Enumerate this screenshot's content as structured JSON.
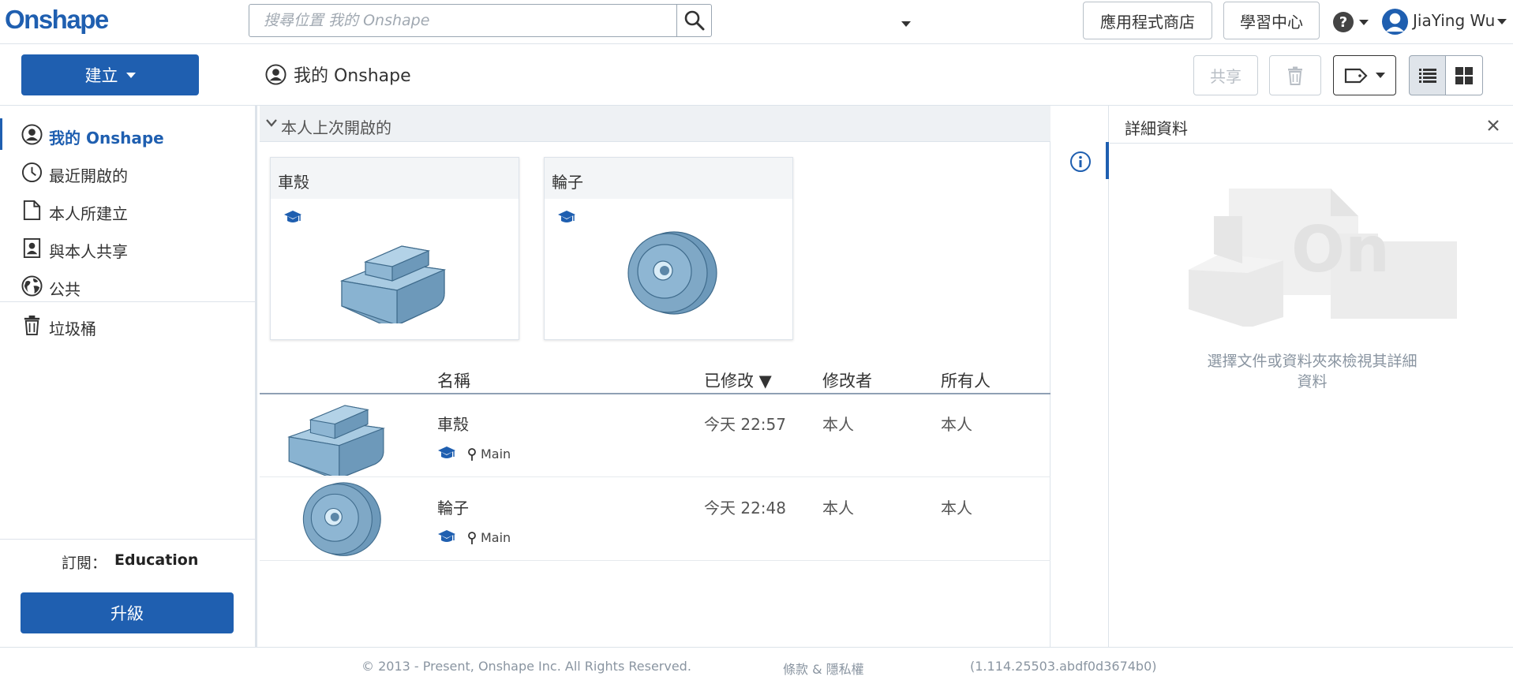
{
  "app": {
    "logo": "Onshape"
  },
  "search": {
    "placeholder": "搜尋位置 我的 Onshape"
  },
  "header": {
    "app_store_label": "應用程式商店",
    "learning_label": "學習中心",
    "user_name": "JiaYing Wu"
  },
  "toolbar": {
    "create_label": "建立",
    "page_title": "我的 Onshape",
    "share_label": "共享"
  },
  "sidebar": {
    "items": [
      {
        "label": "我的 Onshape",
        "icon": "user-circle-icon"
      },
      {
        "label": "最近開啟的",
        "icon": "clock-icon"
      },
      {
        "label": "本人所建立",
        "icon": "document-icon"
      },
      {
        "label": "與本人共享",
        "icon": "shared-user-icon"
      },
      {
        "label": "公共",
        "icon": "globe-icon"
      },
      {
        "label": "垃圾桶",
        "icon": "trash-icon"
      }
    ],
    "subscription_label": "訂閱：",
    "subscription_value": "Education",
    "upgrade_label": "升級"
  },
  "recent": {
    "title": "本人上次開啟的",
    "cards": [
      {
        "title": "車殼",
        "thumb": "car-body-thumbnail"
      },
      {
        "title": "輪子",
        "thumb": "wheel-thumbnail"
      }
    ]
  },
  "table": {
    "columns": {
      "name": "名稱",
      "modified": "已修改 ▼",
      "modified_by": "修改者",
      "owner": "所有人"
    },
    "rows": [
      {
        "name": "車殼",
        "branch": "Main",
        "modified": "今天 22:57",
        "modified_by": "本人",
        "owner": "本人"
      },
      {
        "name": "輪子",
        "branch": "Main",
        "modified": "今天 22:48",
        "modified_by": "本人",
        "owner": "本人"
      }
    ]
  },
  "details": {
    "title": "詳細資料",
    "empty_message": "選擇文件或資料夾來檢視其詳細資料"
  },
  "footer": {
    "copyright": "© 2013 - Present, Onshape Inc. All Rights Reserved.",
    "terms": "條款 & 隱私權",
    "version": "(1.114.25503.abdf0d3674b0)"
  },
  "colors": {
    "accent": "#1f5fb0",
    "border": "#dde3ea",
    "muted": "#8a95a1"
  }
}
